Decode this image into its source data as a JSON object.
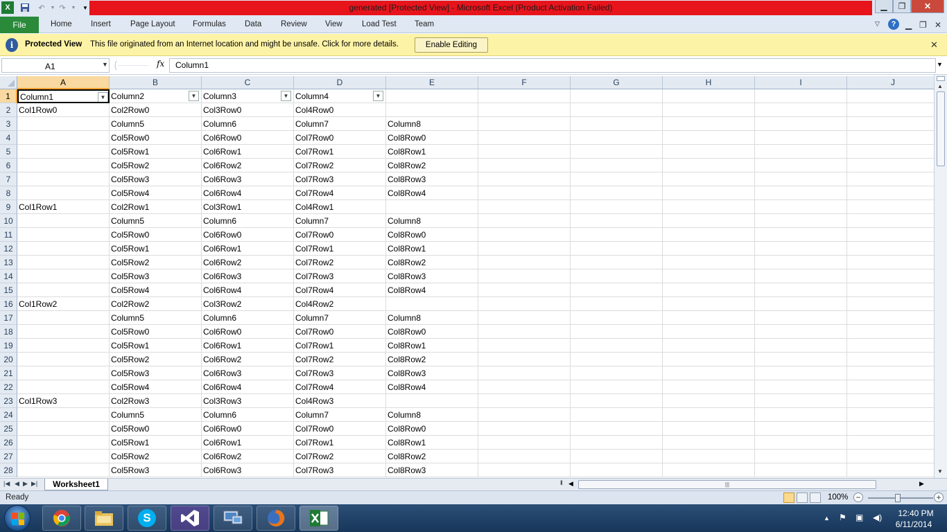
{
  "window": {
    "title": "generated  [Protected View]  -  Microsoft Excel (Product Activation Failed)",
    "title_bg": "#e8141c"
  },
  "ribbon": {
    "file_label": "File",
    "tabs": [
      "Home",
      "Insert",
      "Page Layout",
      "Formulas",
      "Data",
      "Review",
      "View",
      "Load Test",
      "Team"
    ]
  },
  "protected_view": {
    "title": "Protected View",
    "message": "This file originated from an Internet location and might be unsafe. Click for more details.",
    "button": "Enable Editing"
  },
  "formula_bar": {
    "name_box": "A1",
    "fx": "fx",
    "value": "Column1"
  },
  "sheet": {
    "columns": [
      "A",
      "B",
      "C",
      "D",
      "E",
      "F",
      "G",
      "H",
      "I",
      "J"
    ],
    "selected_column": "A",
    "selected_row": 1,
    "rows": [
      {
        "n": "1",
        "cells": [
          "Column1",
          "Column2",
          "Column3",
          "Column4",
          "",
          "",
          "",
          "",
          "",
          ""
        ]
      },
      {
        "n": "2",
        "cells": [
          "Col1Row0",
          "Col2Row0",
          "Col3Row0",
          "Col4Row0",
          "",
          "",
          "",
          "",
          "",
          ""
        ]
      },
      {
        "n": "3",
        "cells": [
          "",
          "Column5",
          "Column6",
          "Column7",
          "Column8",
          "",
          "",
          "",
          "",
          ""
        ]
      },
      {
        "n": "4",
        "cells": [
          "",
          "Col5Row0",
          "Col6Row0",
          "Col7Row0",
          "Col8Row0",
          "",
          "",
          "",
          "",
          ""
        ]
      },
      {
        "n": "5",
        "cells": [
          "",
          "Col5Row1",
          "Col6Row1",
          "Col7Row1",
          "Col8Row1",
          "",
          "",
          "",
          "",
          ""
        ]
      },
      {
        "n": "6",
        "cells": [
          "",
          "Col5Row2",
          "Col6Row2",
          "Col7Row2",
          "Col8Row2",
          "",
          "",
          "",
          "",
          ""
        ]
      },
      {
        "n": "7",
        "cells": [
          "",
          "Col5Row3",
          "Col6Row3",
          "Col7Row3",
          "Col8Row3",
          "",
          "",
          "",
          "",
          ""
        ]
      },
      {
        "n": "8",
        "cells": [
          "",
          "Col5Row4",
          "Col6Row4",
          "Col7Row4",
          "Col8Row4",
          "",
          "",
          "",
          "",
          ""
        ]
      },
      {
        "n": "9",
        "cells": [
          "Col1Row1",
          "Col2Row1",
          "Col3Row1",
          "Col4Row1",
          "",
          "",
          "",
          "",
          "",
          ""
        ]
      },
      {
        "n": "10",
        "cells": [
          "",
          "Column5",
          "Column6",
          "Column7",
          "Column8",
          "",
          "",
          "",
          "",
          ""
        ]
      },
      {
        "n": "11",
        "cells": [
          "",
          "Col5Row0",
          "Col6Row0",
          "Col7Row0",
          "Col8Row0",
          "",
          "",
          "",
          "",
          ""
        ]
      },
      {
        "n": "12",
        "cells": [
          "",
          "Col5Row1",
          "Col6Row1",
          "Col7Row1",
          "Col8Row1",
          "",
          "",
          "",
          "",
          ""
        ]
      },
      {
        "n": "13",
        "cells": [
          "",
          "Col5Row2",
          "Col6Row2",
          "Col7Row2",
          "Col8Row2",
          "",
          "",
          "",
          "",
          ""
        ]
      },
      {
        "n": "14",
        "cells": [
          "",
          "Col5Row3",
          "Col6Row3",
          "Col7Row3",
          "Col8Row3",
          "",
          "",
          "",
          "",
          ""
        ]
      },
      {
        "n": "15",
        "cells": [
          "",
          "Col5Row4",
          "Col6Row4",
          "Col7Row4",
          "Col8Row4",
          "",
          "",
          "",
          "",
          ""
        ]
      },
      {
        "n": "16",
        "cells": [
          "Col1Row2",
          "Col2Row2",
          "Col3Row2",
          "Col4Row2",
          "",
          "",
          "",
          "",
          "",
          ""
        ]
      },
      {
        "n": "17",
        "cells": [
          "",
          "Column5",
          "Column6",
          "Column7",
          "Column8",
          "",
          "",
          "",
          "",
          ""
        ]
      },
      {
        "n": "18",
        "cells": [
          "",
          "Col5Row0",
          "Col6Row0",
          "Col7Row0",
          "Col8Row0",
          "",
          "",
          "",
          "",
          ""
        ]
      },
      {
        "n": "19",
        "cells": [
          "",
          "Col5Row1",
          "Col6Row1",
          "Col7Row1",
          "Col8Row1",
          "",
          "",
          "",
          "",
          ""
        ]
      },
      {
        "n": "20",
        "cells": [
          "",
          "Col5Row2",
          "Col6Row2",
          "Col7Row2",
          "Col8Row2",
          "",
          "",
          "",
          "",
          ""
        ]
      },
      {
        "n": "21",
        "cells": [
          "",
          "Col5Row3",
          "Col6Row3",
          "Col7Row3",
          "Col8Row3",
          "",
          "",
          "",
          "",
          ""
        ]
      },
      {
        "n": "22",
        "cells": [
          "",
          "Col5Row4",
          "Col6Row4",
          "Col7Row4",
          "Col8Row4",
          "",
          "",
          "",
          "",
          ""
        ]
      },
      {
        "n": "23",
        "cells": [
          "Col1Row3",
          "Col2Row3",
          "Col3Row3",
          "Col4Row3",
          "",
          "",
          "",
          "",
          "",
          ""
        ]
      },
      {
        "n": "24",
        "cells": [
          "",
          "Column5",
          "Column6",
          "Column7",
          "Column8",
          "",
          "",
          "",
          "",
          ""
        ]
      },
      {
        "n": "25",
        "cells": [
          "",
          "Col5Row0",
          "Col6Row0",
          "Col7Row0",
          "Col8Row0",
          "",
          "",
          "",
          "",
          ""
        ]
      },
      {
        "n": "26",
        "cells": [
          "",
          "Col5Row1",
          "Col6Row1",
          "Col7Row1",
          "Col8Row1",
          "",
          "",
          "",
          "",
          ""
        ]
      },
      {
        "n": "27",
        "cells": [
          "",
          "Col5Row2",
          "Col6Row2",
          "Col7Row2",
          "Col8Row2",
          "",
          "",
          "",
          "",
          ""
        ]
      },
      {
        "n": "28",
        "cells": [
          "",
          "Col5Row3",
          "Col6Row3",
          "Col7Row3",
          "Col8Row3",
          "",
          "",
          "",
          "",
          ""
        ]
      }
    ]
  },
  "sheet_tabs": [
    "Worksheet1"
  ],
  "status": {
    "ready": "Ready",
    "zoom": "100%",
    "zoom_fraction": 0.5
  },
  "taskbar": {
    "apps": [
      "chrome-icon",
      "explorer-icon",
      "skype-icon",
      "visual-studio-icon",
      "remote-desktop-icon",
      "firefox-icon",
      "excel-icon"
    ],
    "time": "12:40 PM",
    "date": "6/11/2014"
  }
}
